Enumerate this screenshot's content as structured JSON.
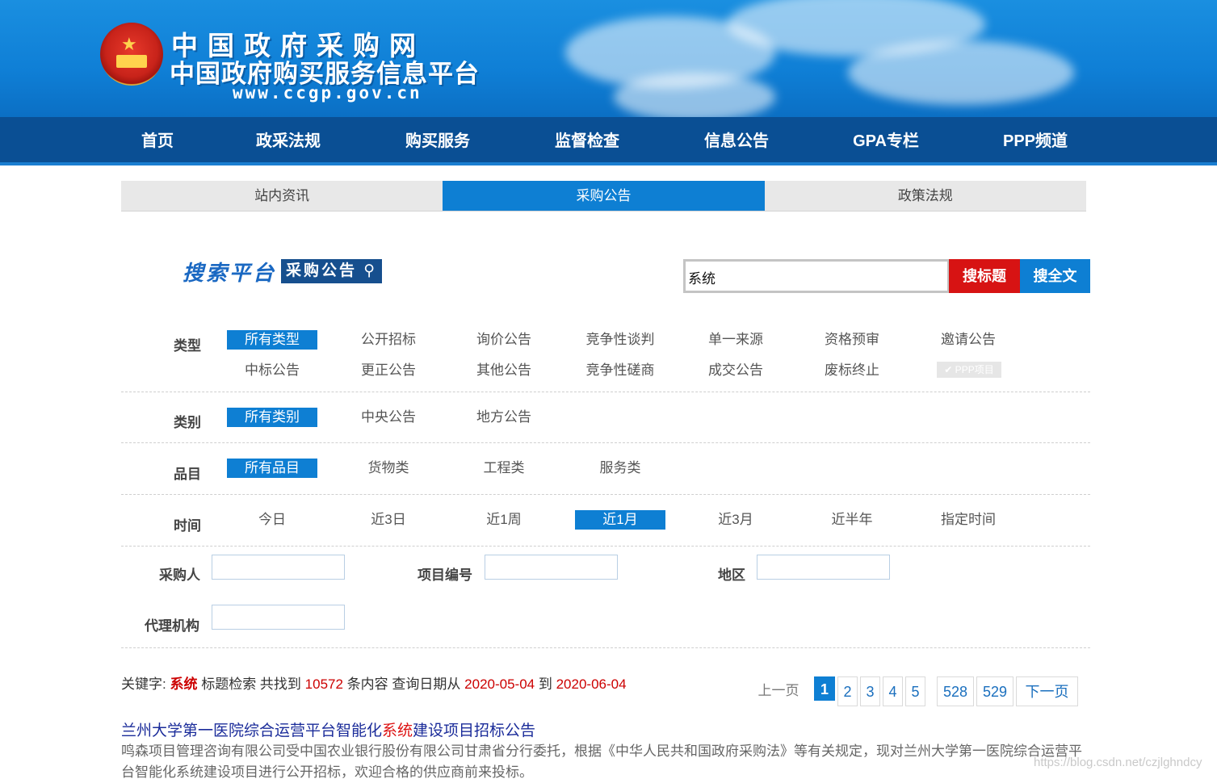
{
  "header": {
    "site_name": "中国政府采购网",
    "site_subtitle": "中国政府购买服务信息平台",
    "site_url": "www.ccgp.gov.cn"
  },
  "main_nav": [
    "首页",
    "政采法规",
    "购买服务",
    "监督检查",
    "信息公告",
    "GPA专栏",
    "PPP频道"
  ],
  "tabs": [
    {
      "label": "站内资讯",
      "active": false
    },
    {
      "label": "采购公告",
      "active": true
    },
    {
      "label": "政策法规",
      "active": false
    }
  ],
  "search": {
    "logo_text": "搜索平台",
    "logo_badge": "采购公告",
    "query": "系统",
    "btn_title": "搜标题",
    "btn_full": "搜全文"
  },
  "filters": {
    "type_label": "类型",
    "type_options": [
      "所有类型",
      "公开招标",
      "询价公告",
      "竞争性谈判",
      "单一来源",
      "资格预审",
      "邀请公告",
      "中标公告",
      "更正公告",
      "其他公告",
      "竞争性磋商",
      "成交公告",
      "废标终止"
    ],
    "ppp_label": "✔ PPP项目",
    "category_label": "类别",
    "category_options": [
      "所有类别",
      "中央公告",
      "地方公告"
    ],
    "item_label": "品目",
    "item_options": [
      "所有品目",
      "货物类",
      "工程类",
      "服务类"
    ],
    "time_label": "时间",
    "time_options": [
      "今日",
      "近3日",
      "近1周",
      "近1月",
      "近3月",
      "近半年",
      "指定时间"
    ],
    "selected": {
      "type": "所有类型",
      "category": "所有类别",
      "item": "所有品目",
      "time": "近1月"
    },
    "buyer_label": "采购人",
    "project_no_label": "项目编号",
    "region_label": "地区",
    "agency_label": "代理机构"
  },
  "results": {
    "kw_prefix": "关键字:",
    "keyword": "系统",
    "mid1": "标题检索 共找到",
    "count": "10572",
    "mid2": "条内容 查询日期从",
    "date_from": "2020-05-04",
    "mid3": "到",
    "date_to": "2020-06-04"
  },
  "pager": {
    "prev": "上一页",
    "pages": [
      "1",
      "2",
      "3",
      "4",
      "5",
      "528",
      "529"
    ],
    "current": "1",
    "next": "下一页"
  },
  "first_result": {
    "title_before": "兰州大学第一医院综合运营平台智能化",
    "title_highlight": "系统",
    "title_after": "建设项目招标公告",
    "desc": "鸣森项目管理咨询有限公司受中国农业银行股份有限公司甘肃省分行委托，根据《中华人民共和国政府采购法》等有关规定，现对兰州大学第一医院综合运营平台智能化系统建设项目进行公开招标，欢迎合格的供应商前来投标。"
  },
  "watermark": "https://blog.csdn.net/czjlghndcy",
  "colors": {
    "accent": "#0e7fd3",
    "nav_bg": "#0a4f94",
    "danger": "#d71313"
  }
}
